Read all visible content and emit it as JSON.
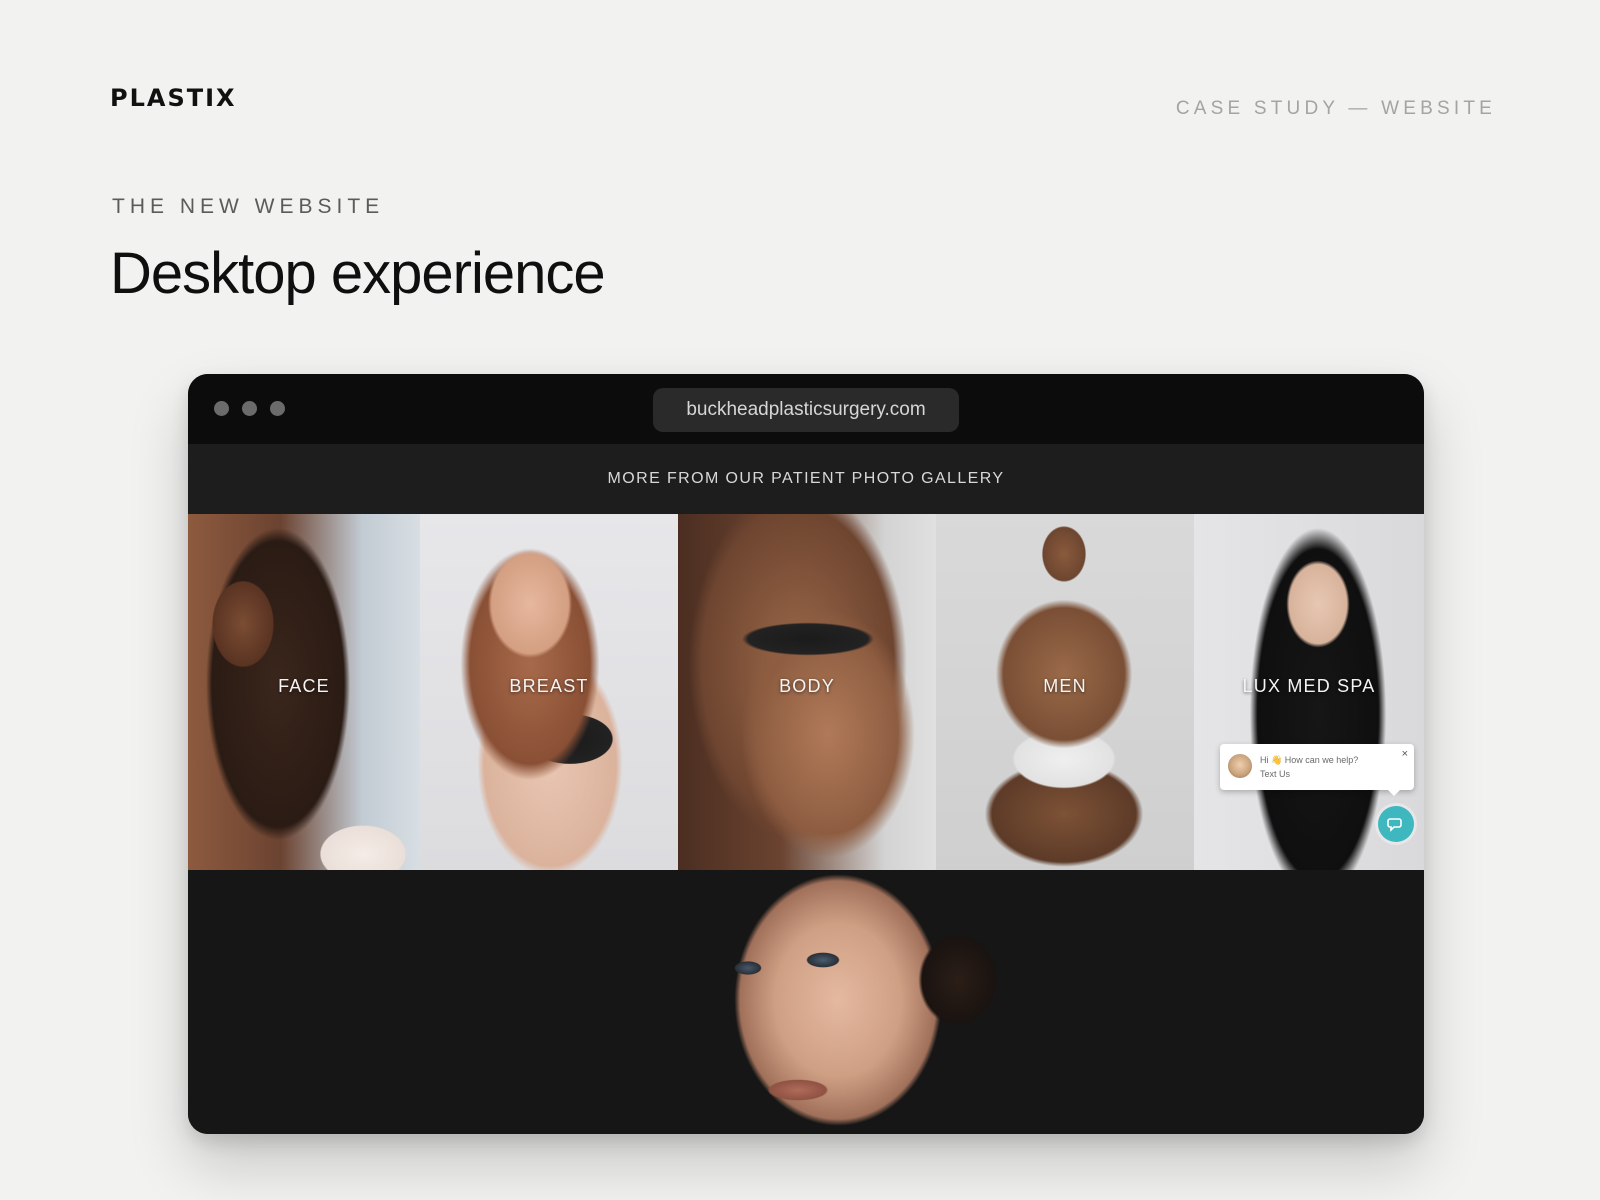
{
  "header": {
    "logo": "PLASTIX",
    "meta": "CASE STUDY — WEBSITE"
  },
  "section": {
    "eyebrow": "THE NEW WEBSITE",
    "title": "Desktop experience"
  },
  "browser": {
    "url": "buckheadplasticsurgery.com",
    "gallery_title": "MORE FROM OUR PATIENT PHOTO GALLERY",
    "tiles": [
      {
        "label": "FACE"
      },
      {
        "label": "BREAST"
      },
      {
        "label": "BODY"
      },
      {
        "label": "MEN"
      },
      {
        "label": "LUX MED SPA"
      }
    ],
    "chat": {
      "message_line1": "Hi 👋 How can we help?",
      "message_line2": "Text Us",
      "close": "×"
    }
  },
  "colors": {
    "page_bg": "#f2f2f0",
    "browser_bg": "#171717",
    "chat_accent": "#3fb7bf"
  }
}
